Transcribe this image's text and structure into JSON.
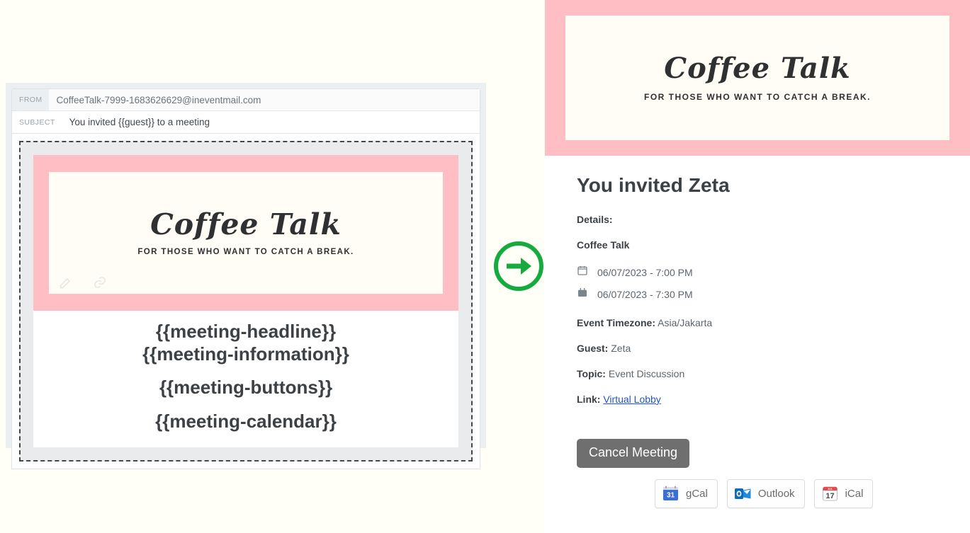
{
  "email_editor": {
    "from_label": "FROM",
    "from_value": "CoffeeTalk-7999-1683626629@ineventmail.com",
    "subject_label": "SUBJECT",
    "subject_value": "You invited {{guest}} to a meeting",
    "banner": {
      "brand": "Coffee Talk",
      "tagline": "FOR THOSE WHO WANT TO CATCH A BREAK."
    },
    "tokens": [
      "{{meeting-headline}}",
      "{{meeting-information}}",
      "{{meeting-buttons}}",
      "{{meeting-calendar}}"
    ],
    "hover_icons": [
      "edit-pencil-icon",
      "link-icon"
    ]
  },
  "arrow": {
    "icon": "arrow-right-circle-icon",
    "color": "#17ab3f"
  },
  "preview": {
    "banner": {
      "brand": "Coffee Talk",
      "tagline": "FOR THOSE WHO WANT TO CATCH A BREAK."
    },
    "title": "You invited Zeta",
    "details_label": "Details:",
    "event_name": "Coffee Talk",
    "start": {
      "icon": "calendar-outline-icon",
      "text": "06/07/2023 - 7:00 PM"
    },
    "end": {
      "icon": "calendar-filled-icon",
      "text": "06/07/2023 - 7:30 PM"
    },
    "timezone_label": "Event Timezone:",
    "timezone_value": "Asia/Jakarta",
    "guest_label": "Guest:",
    "guest_value": "Zeta",
    "topic_label": "Topic:",
    "topic_value": "Event Discussion",
    "link_label": "Link:",
    "link_text": "Virtual Lobby",
    "cancel_button": "Cancel Meeting",
    "calendar_buttons": [
      {
        "label": "gCal",
        "icon": "google-calendar-icon",
        "day": "31"
      },
      {
        "label": "Outlook",
        "icon": "outlook-icon",
        "day": ""
      },
      {
        "label": "iCal",
        "icon": "apple-ical-icon",
        "day": "17"
      }
    ]
  },
  "colors": {
    "page_bg": "#fffff7",
    "banner_pink": "#ffbec4",
    "banner_cream": "#fffdf6",
    "accent_green": "#17ab3f",
    "link_blue": "#2056c7",
    "cancel_gray": "#6f6f6f"
  }
}
